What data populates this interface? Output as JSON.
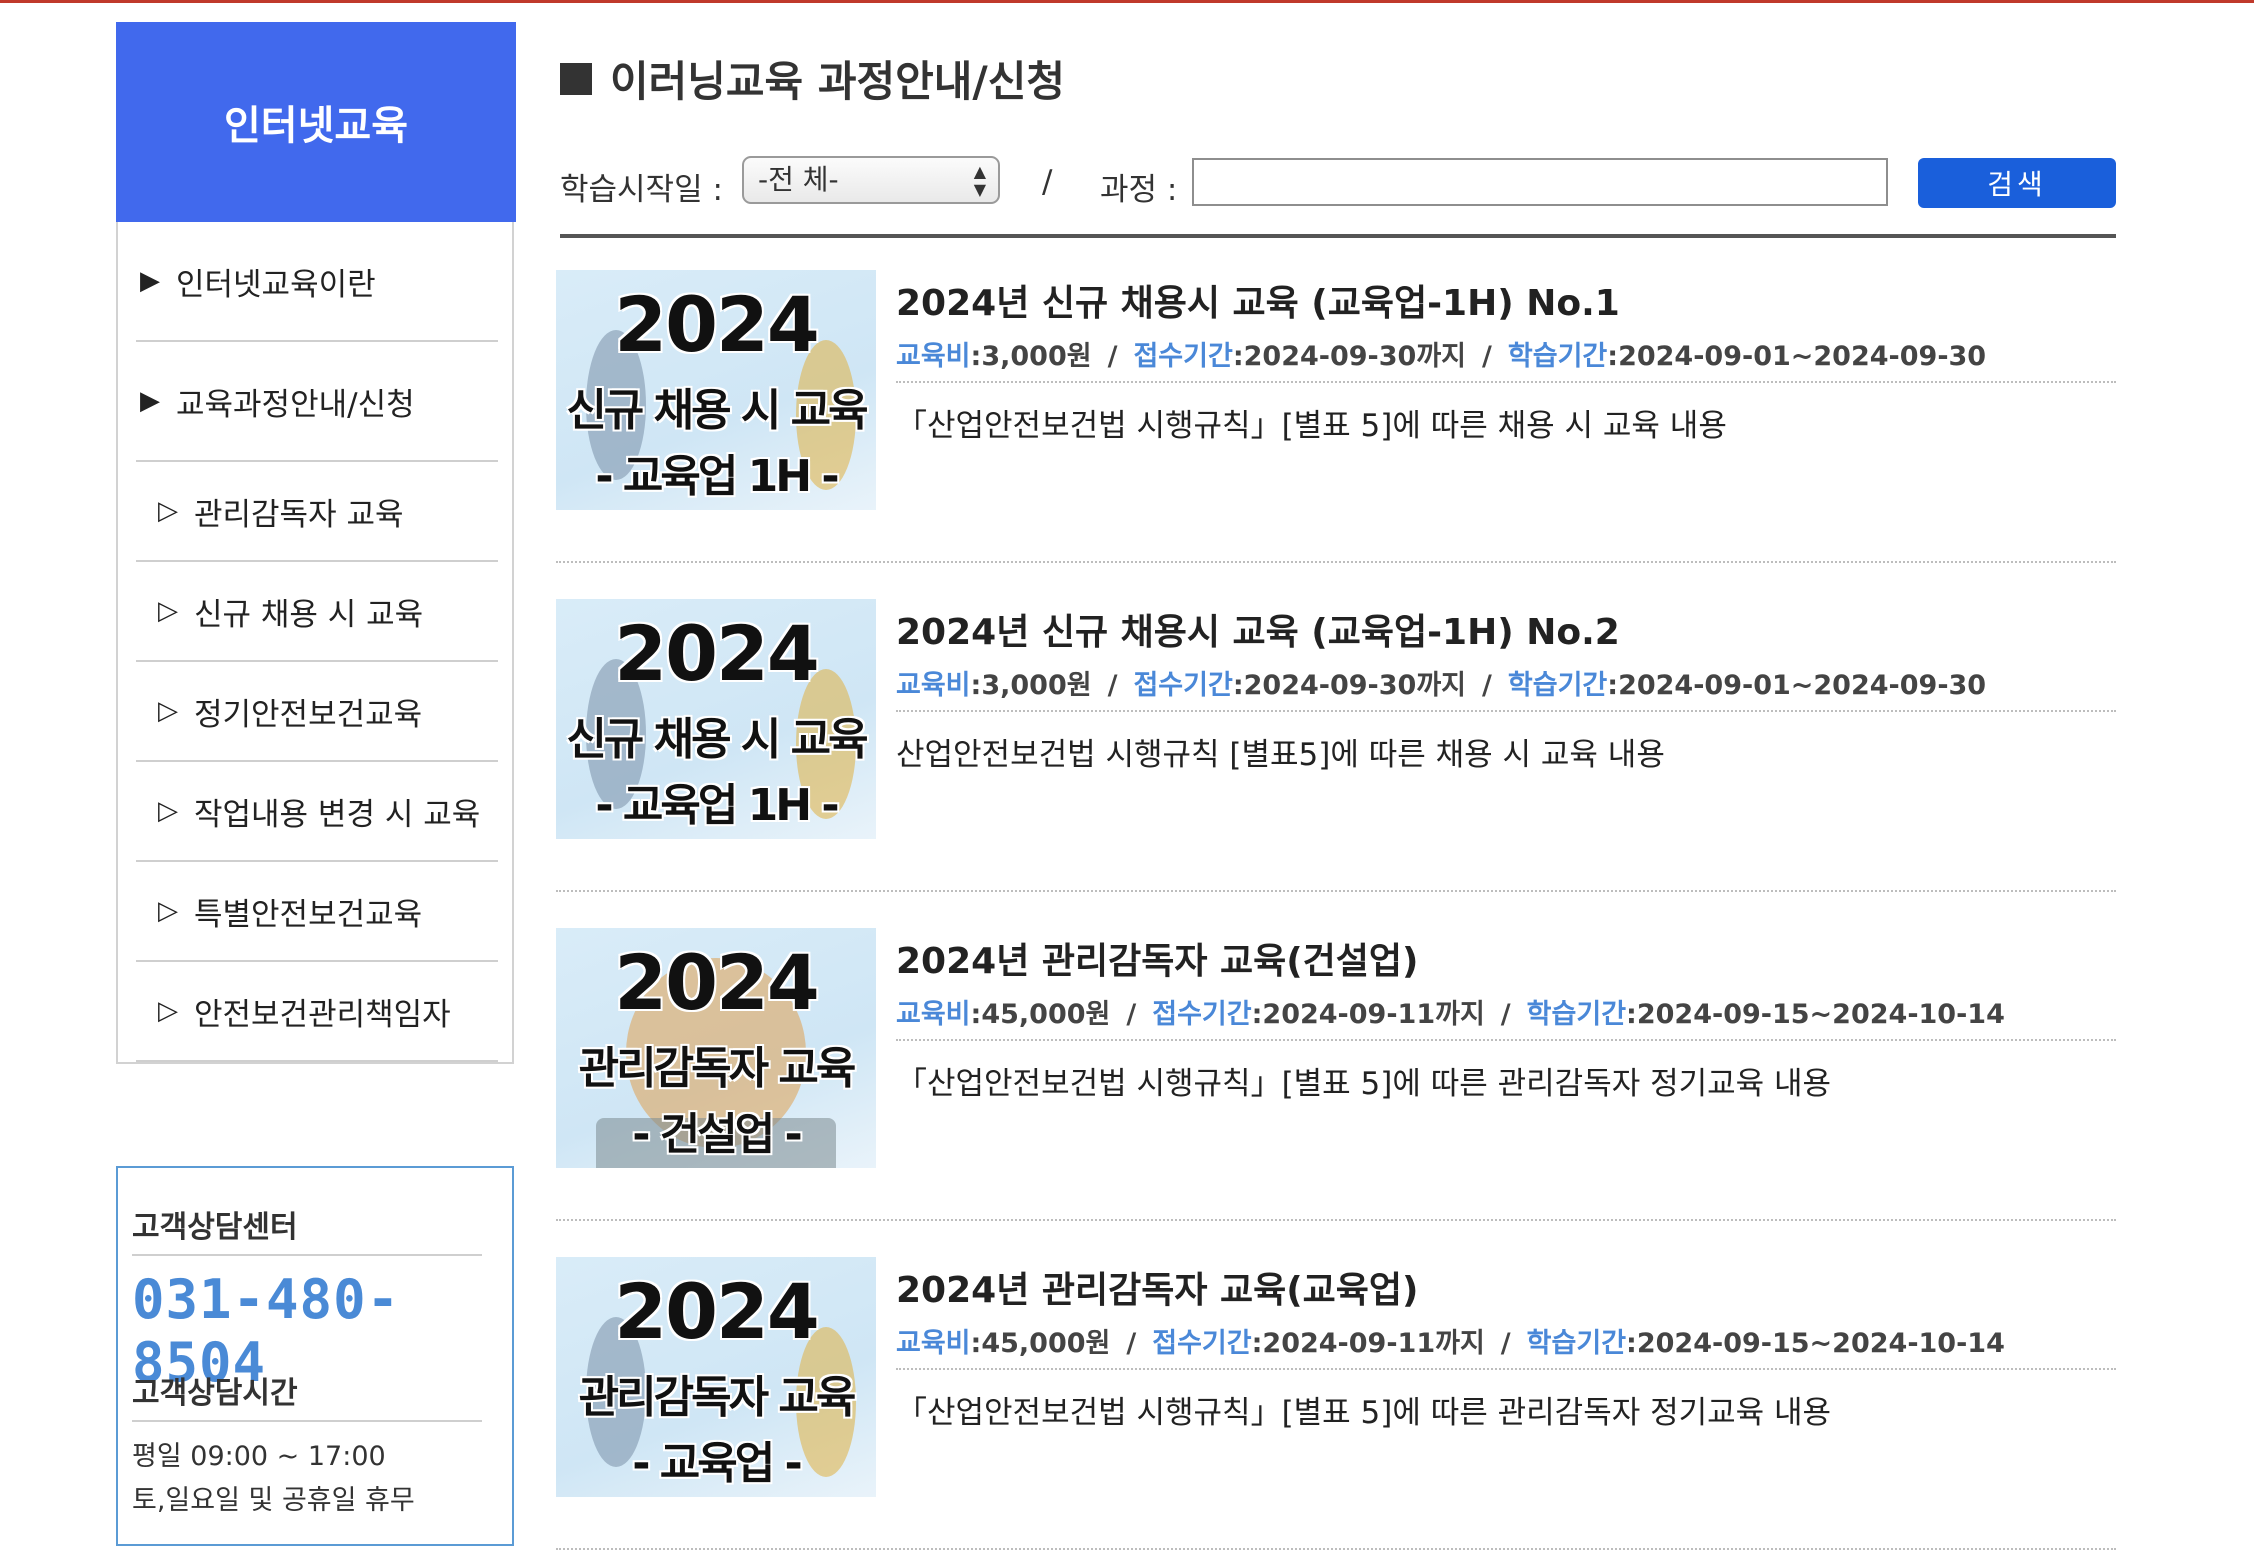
{
  "colors": {
    "top_border": "#c0392b",
    "sidebar_header": "#4169ed",
    "search_button": "#1a5fdb",
    "link_label": "#4a88d8",
    "phone": "#4a8ad6"
  },
  "sidebar": {
    "title": "인터넷교육",
    "items": [
      {
        "label": "인터넷교육이란",
        "level": "main"
      },
      {
        "label": "교육과정안내/신청",
        "level": "main"
      },
      {
        "label": "관리감독자 교육",
        "level": "sub"
      },
      {
        "label": "신규 채용 시 교육",
        "level": "sub"
      },
      {
        "label": "정기안전보건교육",
        "level": "sub"
      },
      {
        "label": "작업내용 변경 시 교육",
        "level": "sub"
      },
      {
        "label": "특별안전보건교육",
        "level": "sub"
      },
      {
        "label": "안전보건관리책임자",
        "level": "sub"
      }
    ],
    "arrow_main": "▶",
    "arrow_sub": "▷"
  },
  "support": {
    "center_title": "고객상담센터",
    "phone": "031-480-8504",
    "hours_title": "고객상담시간",
    "weekday": "평일 09:00 ~ 17:00",
    "holiday": "토,일요일 및 공휴일 휴무"
  },
  "page": {
    "title": "이러닝교육 과정안내/신청"
  },
  "search": {
    "start_label": "학습시작일 :",
    "start_value": "-전 체-",
    "separator": "/",
    "course_label": "과정 :",
    "course_value": "",
    "button": "검색"
  },
  "meta_labels": {
    "fee": "교육비",
    "reception": "접수기간",
    "study": "학습기간"
  },
  "courses": [
    {
      "title": "2024년 신규 채용시 교육 (교육업-1H) No.1",
      "fee": ":3,000원",
      "reception": ":2024-09-30까지",
      "study": ":2024-09-01~2024-09-30",
      "desc": "「산업안전보건법 시행규칙」[별표 5]에 따른 채용 시 교육 내용",
      "thumb": {
        "line1": "2024",
        "line2": "신규 채용 시 교육",
        "line3": "- 교육업 1H -"
      }
    },
    {
      "title": "2024년 신규 채용시 교육 (교육업-1H) No.2",
      "fee": ":3,000원",
      "reception": ":2024-09-30까지",
      "study": ":2024-09-01~2024-09-30",
      "desc": "산업안전보건법 시행규칙 [별표5]에 따른 채용 시 교육 내용",
      "thumb": {
        "line1": "2024",
        "line2": "신규 채용 시 교육",
        "line3": "- 교육업 1H -"
      }
    },
    {
      "title": "2024년 관리감독자 교육(건설업)",
      "fee": ":45,000원",
      "reception": ":2024-09-11까지",
      "study": ":2024-09-15~2024-10-14",
      "desc": "「산업안전보건법 시행규칙」[별표 5]에 따른 관리감독자 정기교육 내용",
      "thumb": {
        "line1": "2024",
        "line2": "관리감독자 교육",
        "line3": "- 건설업 -"
      }
    },
    {
      "title": "2024년 관리감독자 교육(교육업)",
      "fee": ":45,000원",
      "reception": ":2024-09-11까지",
      "study": ":2024-09-15~2024-10-14",
      "desc": "「산업안전보건법 시행규칙」[별표 5]에 따른 관리감독자 정기교육 내용",
      "thumb": {
        "line1": "2024",
        "line2": "관리감독자 교육",
        "line3": "- 교육업 -"
      }
    }
  ]
}
